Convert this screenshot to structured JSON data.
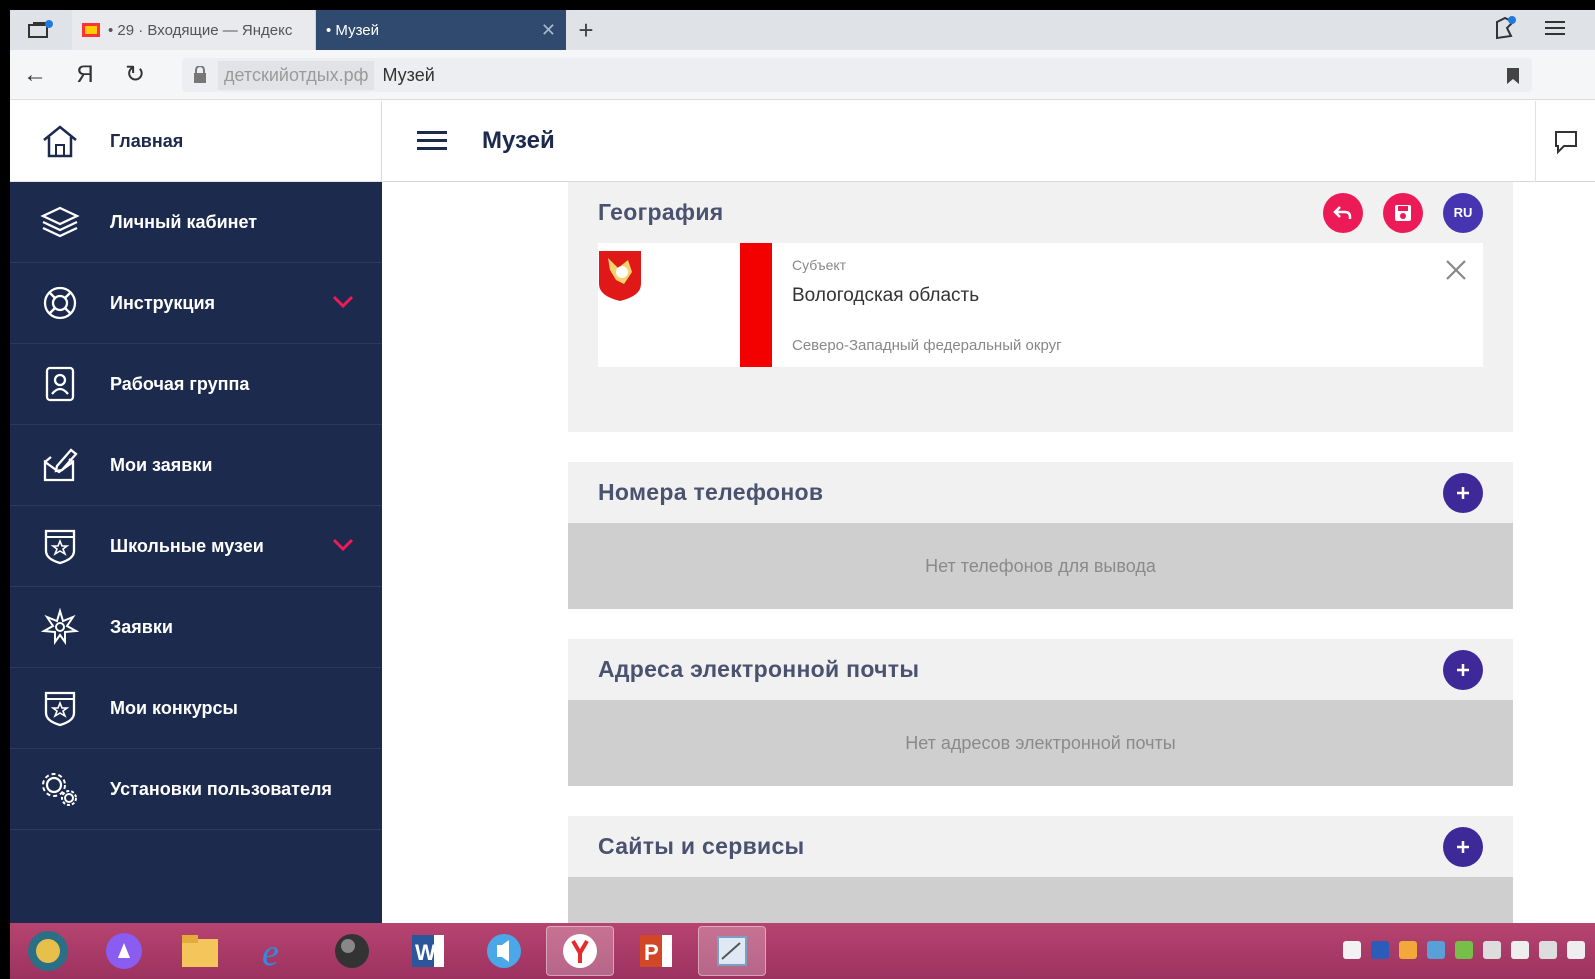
{
  "browser": {
    "tabs": [
      {
        "title": "• 29 · Входящие — Яндекс",
        "active": false
      },
      {
        "title": "• Музей",
        "active": true
      }
    ],
    "url_domain": "детскийотдых.рф",
    "url_path": "Музей",
    "yandex_button": "Я"
  },
  "sidebar": {
    "home_label": "Главная",
    "items": [
      {
        "label": "Личный кабинет",
        "icon": "layers-icon"
      },
      {
        "label": "Инструкция",
        "icon": "lifebuoy-icon",
        "expandable": true
      },
      {
        "label": "Рабочая группа",
        "icon": "id-badge-icon"
      },
      {
        "label": "Мои заявки",
        "icon": "mail-edit-icon"
      },
      {
        "label": "Школьные музеи",
        "icon": "shield-star-icon",
        "expandable": true
      },
      {
        "label": "Заявки",
        "icon": "sparkle-icon"
      },
      {
        "label": "Мои конкурсы",
        "icon": "shield-star-icon"
      },
      {
        "label": "Установки пользователя",
        "icon": "gears-icon"
      }
    ]
  },
  "header": {
    "title": "Музей"
  },
  "geography": {
    "title": "География",
    "lang_button": "RU",
    "subject_caption": "Субъект",
    "subject_name": "Вологодская область",
    "district": "Северо-Западный федеральный округ"
  },
  "phones": {
    "title": "Номера телефонов",
    "empty_text": "Нет телефонов для вывода"
  },
  "emails": {
    "title": "Адреса электронной почты",
    "empty_text": "Нет адресов электронной почты"
  },
  "sites": {
    "title": "Сайты и сервисы"
  },
  "colors": {
    "sidebar_bg": "#1b2a4d",
    "accent_red": "#ec1b57",
    "accent_purple": "#3d2a98",
    "taskbar": "#b74470"
  }
}
